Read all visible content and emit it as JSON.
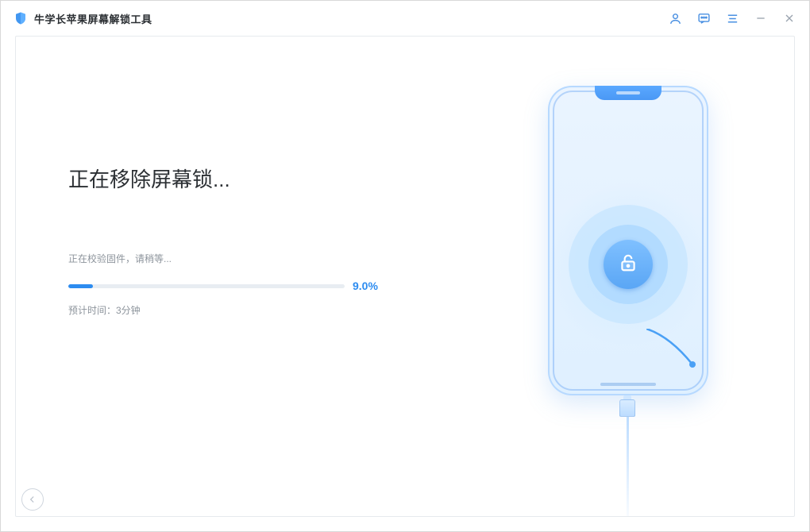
{
  "app": {
    "title": "牛学长苹果屏幕解锁工具"
  },
  "main": {
    "heading": "正在移除屏幕锁...",
    "status": "正在校验固件，请稍等...",
    "progress_percent": 9.0,
    "progress_label": "9.0%",
    "eta": "预计时间：3分钟"
  }
}
